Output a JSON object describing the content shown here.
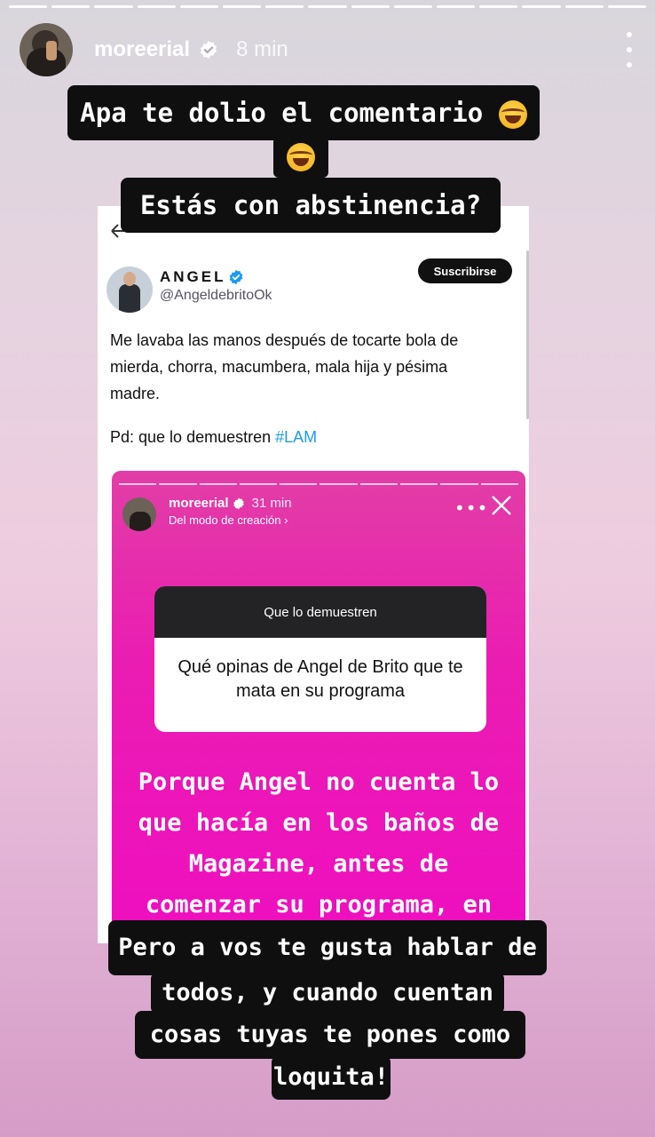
{
  "story": {
    "username": "moreerial",
    "time": "8 min",
    "segment_count": 15
  },
  "captions": {
    "top_line1": "Apa te dolio el comentario",
    "top_line3": "Estás con abstinencia?",
    "bottom_line1": "Pero a vos te gusta hablar de",
    "bottom_line2": "todos, y cuando cuentan",
    "bottom_line3": "cosas tuyas te pones como",
    "bottom_line4": "loquita!"
  },
  "tweet": {
    "name": "ANGEL",
    "handle": "@AngeldebritoOk",
    "subscribe_label": "Suscribirse",
    "body": "Me lavaba las manos después de tocarte bola de mierda,  chorra, macumbera, mala hija y pésima madre.",
    "ps_text": "Pd: que lo demuestren",
    "hashtag": "#LAM"
  },
  "inner_story": {
    "username": "moreerial",
    "time": "31 min",
    "subtitle": "Del modo de creación ›",
    "question_title": "Que lo demuestren",
    "question_text": "Qué opinas de Angel de Brito que te mata en su programa",
    "answer_line1": "Porque Angel no cuenta lo",
    "answer_line2": "que hacía en los baños de",
    "answer_line3": "Magazine, antes de",
    "answer_line4": "comenzar su programa, en"
  },
  "colors": {
    "verified": "#1d9bf0",
    "inner_bg": "#ea1db2",
    "caption_bg": "#0f0f10"
  }
}
